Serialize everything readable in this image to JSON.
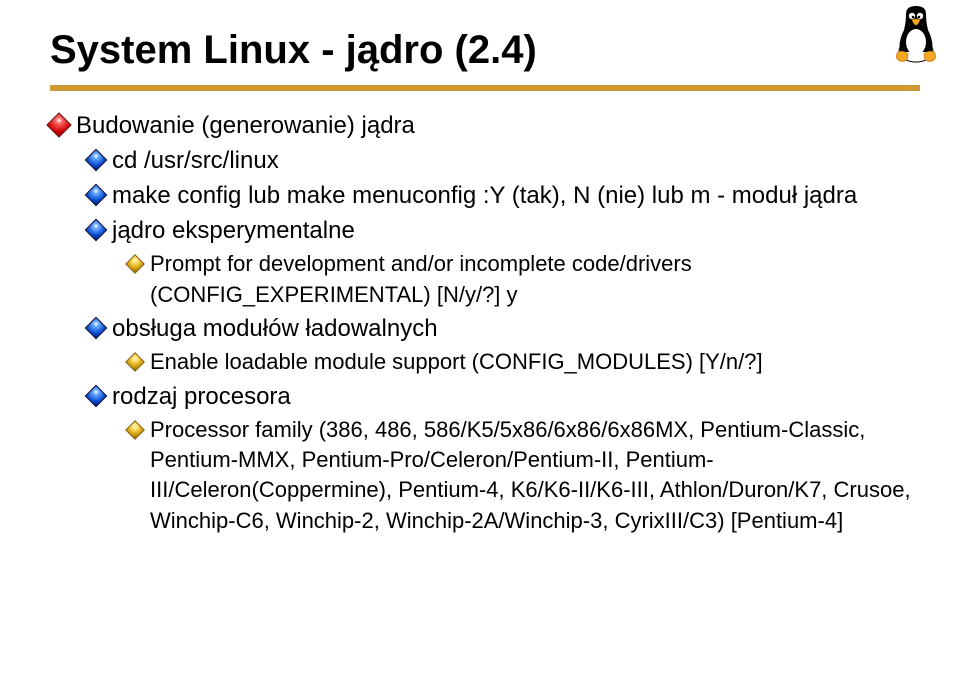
{
  "title": "System Linux  - jądro (2.4)",
  "tux_alt": "Linux Tux mascot icon",
  "items": {
    "i0": {
      "label": "Budowanie  (generowanie) jądra",
      "children": {
        "c0": {
          "label": "cd /usr/src/linux"
        },
        "c1": {
          "label": "make config lub make menuconfig :Y (tak), N (nie) lub m - moduł jądra"
        },
        "c2": {
          "label": "jądro eksperymentalne",
          "sub": {
            "s0": "Prompt for development and/or incomplete code/drivers (CONFIG_EXPERIMENTAL) [N/y/?]  y"
          }
        },
        "c3": {
          "label": "obsługa modułów ładowalnych",
          "sub": {
            "s0": "Enable loadable module support (CONFIG_MODULES) [Y/n/?]"
          }
        },
        "c4": {
          "label": "rodzaj procesora",
          "sub": {
            "s0": "Processor family (386, 486, 586/K5/5x86/6x86/6x86MX, Pentium-Classic, Pentium-MMX, Pentium-Pro/Celeron/Pentium-II, Pentium-III/Celeron(Coppermine), Pentium-4, K6/K6-II/K6-III, Athlon/Duron/K7, Crusoe, Winchip-C6, Winchip-2, Winchip-2A/Winchip-3, CyrixIII/C3) [Pentium-4]"
          }
        }
      }
    }
  }
}
